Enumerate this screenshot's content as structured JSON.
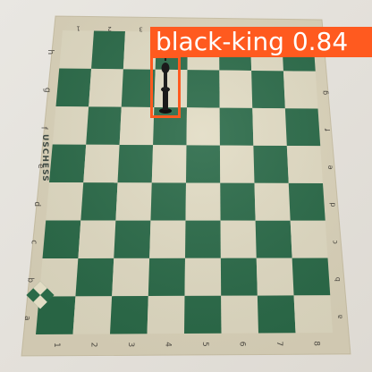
{
  "board": {
    "brand": "USCHESS",
    "files": [
      "a",
      "b",
      "c",
      "d",
      "e",
      "f",
      "g",
      "h"
    ],
    "ranks": [
      "1",
      "2",
      "3",
      "4",
      "5",
      "6",
      "7",
      "8"
    ],
    "colors": {
      "light_square": "#e2dcc4",
      "dark_square": "#2a6a48",
      "border": "#ddd5bc",
      "coordinates": "#4d4a43",
      "piece": "#1b1b1b"
    }
  },
  "detection": {
    "piece_label": "black-king",
    "score": "0.84",
    "color": "#ff5a1f"
  }
}
